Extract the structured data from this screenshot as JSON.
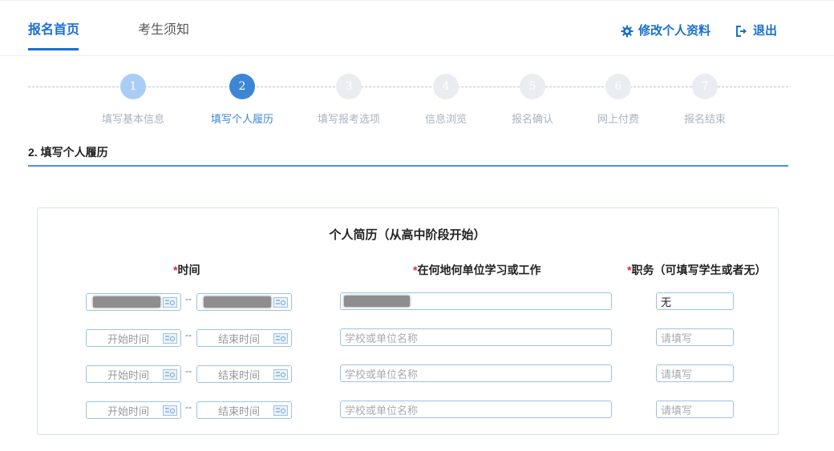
{
  "nav": {
    "tabs": [
      {
        "label": "报名首页",
        "active": true
      },
      {
        "label": "考生须知",
        "active": false
      }
    ],
    "edit_profile": {
      "label": "修改个人资料",
      "icon": "gear-icon"
    },
    "logout": {
      "label": "退出",
      "icon": "logout-icon"
    },
    "accent_color": "#1a6fd1"
  },
  "steps": [
    {
      "number": "1",
      "label": "填写基本信息",
      "state": "done"
    },
    {
      "number": "2",
      "label": "填写个人履历",
      "state": "current"
    },
    {
      "number": "3",
      "label": "填写报考选项",
      "state": "todo"
    },
    {
      "number": "4",
      "label": "信息浏览",
      "state": "todo"
    },
    {
      "number": "5",
      "label": "报名确认",
      "state": "todo"
    },
    {
      "number": "6",
      "label": "网上付费",
      "state": "todo"
    },
    {
      "number": "7",
      "label": "报名结束",
      "state": "todo"
    }
  ],
  "section_title": "2. 填写个人履历",
  "resume": {
    "title": "个人简历（从高中阶段开始）",
    "columns": {
      "required_mark": "*",
      "time": "时间",
      "place": "在何地何单位学习或工作",
      "position": "职务（可填写学生或者无）"
    },
    "separator": "--",
    "rows": [
      {
        "start": "",
        "end": "",
        "place": "",
        "position": "无",
        "redacted": true
      },
      {
        "start_placeholder": "开始时间",
        "end_placeholder": "结束时间",
        "place_placeholder": "学校或单位名称",
        "position_placeholder": "请填写"
      },
      {
        "start_placeholder": "开始时间",
        "end_placeholder": "结束时间",
        "place_placeholder": "学校或单位名称",
        "position_placeholder": "请填写"
      },
      {
        "start_placeholder": "开始时间",
        "end_placeholder": "结束时间",
        "place_placeholder": "学校或单位名称",
        "position_placeholder": "请填写"
      }
    ]
  }
}
